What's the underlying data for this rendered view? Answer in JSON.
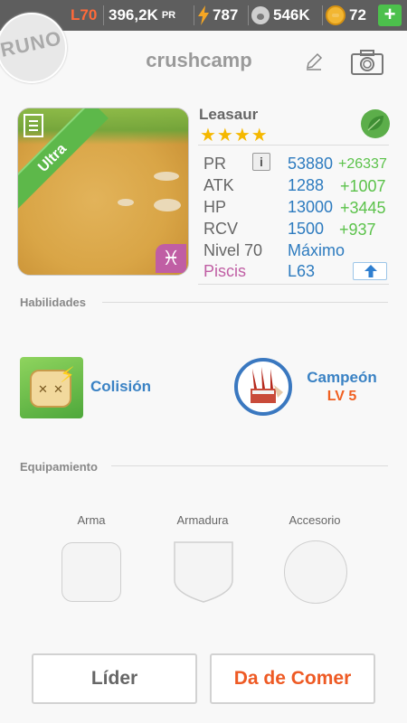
{
  "status_bar": {
    "level": "L70",
    "pr": "396,2K",
    "pr_suffix": "PR",
    "energy": "787",
    "food": "546K",
    "coins": "72",
    "add_label": "+"
  },
  "header": {
    "avatar_text": "RUNO",
    "username": "crushcamp"
  },
  "monster": {
    "rarity": "Ultra",
    "name": "Leasaur",
    "stars": "★★★★",
    "element_icon": "leaf-icon",
    "zodiac_icon": "pisces-icon",
    "zodiac_symbol": "♓",
    "stats": [
      {
        "label": "PR",
        "value": "53880",
        "bonus": "+26337"
      },
      {
        "label": "ATK",
        "value": "1288",
        "bonus": "+1007"
      },
      {
        "label": "HP",
        "value": "13000",
        "bonus": "+3445"
      },
      {
        "label": "RCV",
        "value": "1500",
        "bonus": "+937"
      }
    ],
    "level_label": "Nivel 70",
    "level_value": "Máximo",
    "zodiac_label": "Piscis",
    "zodiac_level": "L63",
    "info_label": "i"
  },
  "abilities": {
    "title": "Habilidades",
    "skill_name": "Colisión",
    "leader_name": "Campeón",
    "leader_level": "LV 5"
  },
  "equipment": {
    "title": "Equipamiento",
    "weapon_label": "Arma",
    "armor_label": "Armadura",
    "accessory_label": "Accesorio"
  },
  "actions": {
    "leader_button": "Líder",
    "feed_button": "Da de Comer"
  },
  "colors": {
    "accent_blue": "#2d7bbf",
    "bonus_green": "#5bc24a",
    "orange": "#f06021",
    "zodiac_pink": "#c05ea4"
  }
}
